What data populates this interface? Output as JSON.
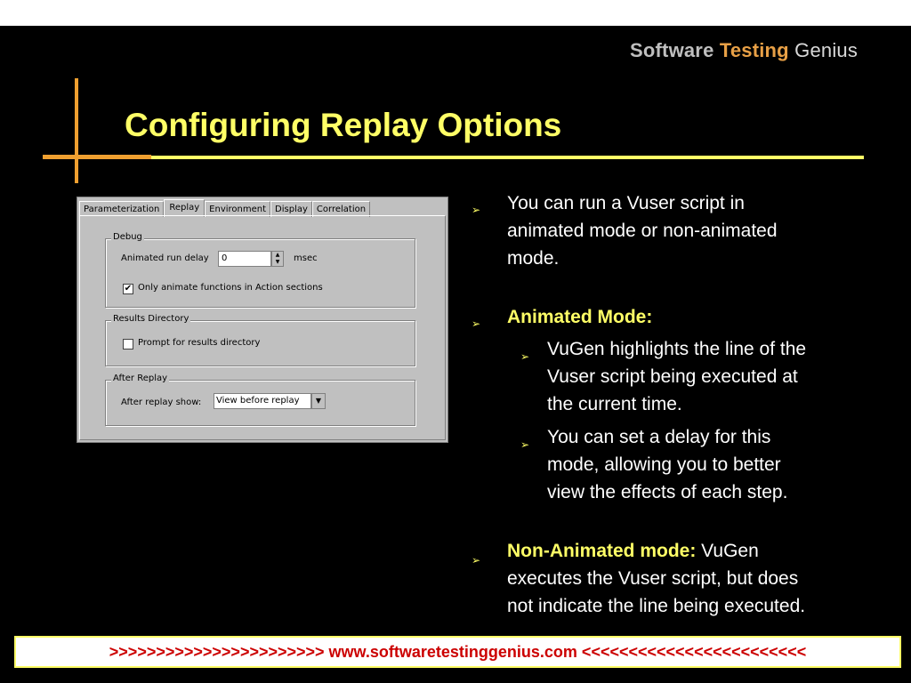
{
  "logo": {
    "part1": "Software ",
    "part2": "Testing",
    "part3": " Genius"
  },
  "title": "Configuring Replay Options",
  "dialog": {
    "tabs": [
      "Parameterization",
      "Replay",
      "Environment",
      "Display",
      "Correlation"
    ],
    "active_tab": "Replay",
    "debug": {
      "group_label": "Debug",
      "delay_label": "Animated run delay",
      "delay_value": "0",
      "delay_unit": "msec",
      "only_animate_label": "Only animate functions in Action sections",
      "only_animate_checked": "✔"
    },
    "results": {
      "group_label": "Results Directory",
      "prompt_label": "Prompt for results directory"
    },
    "after_replay": {
      "group_label": "After Replay",
      "show_label": "After replay show:",
      "show_value": "View before replay",
      "dropdown_arrow": "▼"
    },
    "spin_up": "▲",
    "spin_down": "▼"
  },
  "bullets": {
    "b1": [
      "You can run a Vuser script in",
      "animated mode or non-animated",
      "mode."
    ],
    "b2_title": "Animated Mode:",
    "b2a": [
      "VuGen highlights the line of the",
      "Vuser script being executed at",
      "the current time."
    ],
    "b2b": [
      "You can set a delay for this",
      "mode, allowing you to better",
      "view the effects of each step."
    ],
    "b3_title": "Non-Animated mode:",
    "b3_rest": " VuGen",
    "b3": [
      "executes the Vuser script, but does",
      "not indicate the line being executed."
    ],
    "arrow": "➢"
  },
  "footer": ">>>>>>>>>>>>>>>>>>>>>>>  www.softwaretestinggenius.com  <<<<<<<<<<<<<<<<<<<<<<<<"
}
